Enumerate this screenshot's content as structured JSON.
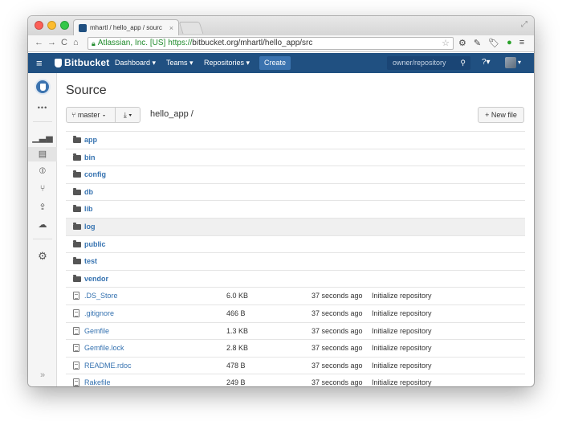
{
  "browser": {
    "tab_title": "mhartl / hello_app / sourc",
    "tab_close": "×",
    "ev_label": "Atlassian, Inc. [US]",
    "url_scheme": "https://",
    "url_rest": "bitbucket.org/mhartl/hello_app/src"
  },
  "header": {
    "logo": "Bitbucket",
    "nav": [
      "Dashboard ▾",
      "Teams ▾",
      "Repositories ▾"
    ],
    "create": "Create",
    "search_placeholder": "owner/repository",
    "help": "?▾"
  },
  "page": {
    "title": "Source",
    "branch": "master ▾",
    "download": "⤓ ▾",
    "path": "hello_app /",
    "new_file": "+ New file"
  },
  "sidebar": {
    "more": "•••",
    "expand": "»"
  },
  "folders": [
    "app",
    "bin",
    "config",
    "db",
    "lib",
    "log",
    "public",
    "test",
    "vendor"
  ],
  "files": [
    {
      "name": ".DS_Store",
      "size": "6.0 KB",
      "date": "37 seconds ago",
      "message": "Initialize repository"
    },
    {
      "name": ".gitignore",
      "size": "466 B",
      "date": "37 seconds ago",
      "message": "Initialize repository"
    },
    {
      "name": "Gemfile",
      "size": "1.3 KB",
      "date": "37 seconds ago",
      "message": "Initialize repository"
    },
    {
      "name": "Gemfile.lock",
      "size": "2.8 KB",
      "date": "37 seconds ago",
      "message": "Initialize repository"
    },
    {
      "name": "README.rdoc",
      "size": "478 B",
      "date": "37 seconds ago",
      "message": "Initialize repository"
    },
    {
      "name": "Rakefile",
      "size": "249 B",
      "date": "37 seconds ago",
      "message": "Initialize repository"
    }
  ],
  "highlighted_folder": "log",
  "colors": {
    "brand": "#205081",
    "link": "#3572b0",
    "create_button": "#3b73af"
  }
}
